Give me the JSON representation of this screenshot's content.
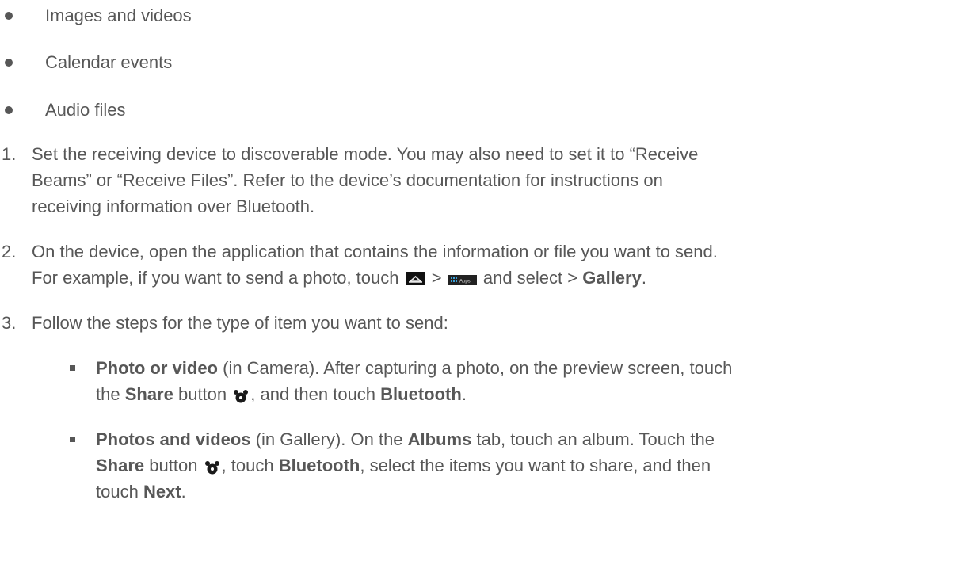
{
  "bullets": [
    "Images and videos",
    "Calendar events",
    "Audio files"
  ],
  "steps": [
    {
      "number": "1.",
      "line1": "Set the receiving device to discoverable mode. You may also need to set it to “Receive",
      "line2": "Beams” or “Receive Files”. Refer to the device’s documentation for instructions on",
      "line3": "receiving information over Bluetooth."
    },
    {
      "number": "2.",
      "line1": "On the device, open the application that contains the information or file you want to send.",
      "line2_pre": "For example, if you want to send a photo, touch",
      "line2_sep": ">",
      "line2_mid": "and select >",
      "line2_bold": "Gallery",
      "line2_end": "."
    },
    {
      "number": "3.",
      "line1": "Follow the steps for the type of item you want to send:"
    }
  ],
  "subitems": [
    {
      "bold1": "Photo or video",
      "t1": " (in Camera). After capturing a photo, on the preview screen, touch",
      "t2": "the ",
      "bold2": "Share",
      "t3": " button ",
      "t4": ", and then touch ",
      "bold3": "Bluetooth",
      "t5": "."
    },
    {
      "bold1": "Photos and videos",
      "t1": " (in Gallery). On the ",
      "bold2": "Albums",
      "t2": " tab, touch an album. Touch the",
      "bold3": "Share",
      "t3": " button ",
      "t4": ", touch ",
      "bold4": "Bluetooth",
      "t5": ", select the items you want to share, and then",
      "t6": "touch ",
      "bold5": "Next",
      "t7": "."
    }
  ],
  "icons": {
    "home": "home-icon",
    "apps": "apps-icon",
    "apps_label": "Apps",
    "share": "share-icon"
  }
}
